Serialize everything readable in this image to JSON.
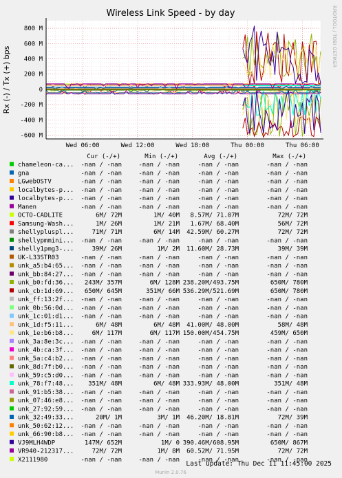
{
  "chart_data": {
    "type": "line",
    "title": "Wireless Link Speed - by day",
    "ylabel": "Rx (-) / Tx (+) bps",
    "ylim": [
      -650,
      900
    ],
    "yticks": [
      {
        "v": 800,
        "label": "800 M"
      },
      {
        "v": 600,
        "label": "600 M"
      },
      {
        "v": 400,
        "label": "400 M"
      },
      {
        "v": 200,
        "label": "200 M"
      },
      {
        "v": 0,
        "label": "0"
      },
      {
        "v": -200,
        "label": "-200 M"
      },
      {
        "v": -400,
        "label": "-400 M"
      },
      {
        "v": -600,
        "label": "-600 M"
      }
    ],
    "xlim": [
      0,
      30
    ],
    "xticks": [
      {
        "v": 4,
        "label": "Wed 06:00"
      },
      {
        "v": 10,
        "label": "Wed 12:00"
      },
      {
        "v": 16,
        "label": "Wed 18:00"
      },
      {
        "v": 22,
        "label": "Thu 00:00"
      },
      {
        "v": 28,
        "label": "Thu 06:00"
      }
    ],
    "side_label": "RRDTOOL / TOBI OETIKER",
    "columns": [
      "Cur (-/+)",
      "Min (-/+)",
      "Avg (-/+)",
      "Max (-/+)"
    ],
    "series": [
      {
        "name": "chameleon-ca...",
        "color": "#00cc00",
        "cur": "-nan / -nan",
        "min": "-nan / -nan",
        "avg": "-nan / -nan",
        "max": "-nan / -nan"
      },
      {
        "name": "gna",
        "color": "#0066b3",
        "cur": "-nan / -nan",
        "min": "-nan / -nan",
        "avg": "-nan / -nan",
        "max": "-nan / -nan"
      },
      {
        "name": "LGwebOSTV",
        "color": "#ff8000",
        "cur": "-nan / -nan",
        "min": "-nan / -nan",
        "avg": "-nan / -nan",
        "max": "-nan / -nan"
      },
      {
        "name": "localbytes-p...",
        "color": "#ffcc00",
        "cur": "-nan / -nan",
        "min": "-nan / -nan",
        "avg": "-nan / -nan",
        "max": "-nan / -nan"
      },
      {
        "name": "localbytes-p...",
        "color": "#330099",
        "cur": "-nan / -nan",
        "min": "-nan / -nan",
        "avg": "-nan / -nan",
        "max": "-nan / -nan"
      },
      {
        "name": "Manen",
        "color": "#990099",
        "cur": "-nan / -nan",
        "min": "-nan / -nan",
        "avg": "-nan / -nan",
        "max": "-nan / -nan"
      },
      {
        "name": "OCTO-CADLITE",
        "color": "#ccff00",
        "cur": "6M/ 72M",
        "min": "1M/ 40M",
        "avg": "8.57M/ 71.07M",
        "max": "72M/ 72M"
      },
      {
        "name": "Samsung-Wash...",
        "color": "#ff0000",
        "cur": "1M/ 26M",
        "min": "1M/ 21M",
        "avg": "1.67M/ 68.40M",
        "max": "56M/ 72M"
      },
      {
        "name": "shellypluspl...",
        "color": "#808080",
        "cur": "71M/ 71M",
        "min": "6M/ 14M",
        "avg": "42.59M/ 60.27M",
        "max": "72M/ 72M"
      },
      {
        "name": "shellypmmini...",
        "color": "#008f00",
        "cur": "-nan / -nan",
        "min": "-nan / -nan",
        "avg": "-nan / -nan",
        "max": "-nan / -nan"
      },
      {
        "name": "shelly1pmg3-...",
        "color": "#00487d",
        "cur": "39M/ 26M",
        "min": "1M/ 2M",
        "avg": "11.60M/ 28.73M",
        "max": "39M/ 39M"
      },
      {
        "name": "UK-L33STR03",
        "color": "#b35a00",
        "cur": "-nan / -nan",
        "min": "-nan / -nan",
        "avg": "-nan / -nan",
        "max": "-nan / -nan"
      },
      {
        "name": "unk_a5:b4:65...",
        "color": "#b38f00",
        "cur": "-nan / -nan",
        "min": "-nan / -nan",
        "avg": "-nan / -nan",
        "max": "-nan / -nan"
      },
      {
        "name": "unk_bb:84:27...",
        "color": "#6b006b",
        "cur": "-nan / -nan",
        "min": "-nan / -nan",
        "avg": "-nan / -nan",
        "max": "-nan / -nan"
      },
      {
        "name": "unk_b0:fd:36...",
        "color": "#8fb300",
        "cur": "243M/ 357M",
        "min": "6M/ 128M",
        "avg": "238.20M/493.75M",
        "max": "650M/ 780M"
      },
      {
        "name": "unk_cb:1d:69...",
        "color": "#b30000",
        "cur": "650M/ 645M",
        "min": "351M/ 66M",
        "avg": "536.29M/521.69M",
        "max": "650M/ 780M"
      },
      {
        "name": "unk_ff:13:2f...",
        "color": "#bebebe",
        "cur": "-nan / -nan",
        "min": "-nan / -nan",
        "avg": "-nan / -nan",
        "max": "-nan / -nan"
      },
      {
        "name": "unk_0b:56:0d...",
        "color": "#80ff80",
        "cur": "-nan / -nan",
        "min": "-nan / -nan",
        "avg": "-nan / -nan",
        "max": "-nan / -nan"
      },
      {
        "name": "unk_1c:01:d1...",
        "color": "#80c9ff",
        "cur": "-nan / -nan",
        "min": "-nan / -nan",
        "avg": "-nan / -nan",
        "max": "-nan / -nan"
      },
      {
        "name": "unk_1d:f5:11...",
        "color": "#ffc080",
        "cur": "6M/ 48M",
        "min": "6M/ 48M",
        "avg": "41.00M/ 48.00M",
        "max": "58M/ 48M"
      },
      {
        "name": "unk_1e:b6:b8...",
        "color": "#ffe680",
        "cur": "6M/ 117M",
        "min": "6M/ 117M",
        "avg": "150.00M/454.75M",
        "max": "459M/ 650M"
      },
      {
        "name": "unk_3a:8e:3c...",
        "color": "#aa80ff",
        "cur": "-nan / -nan",
        "min": "-nan / -nan",
        "avg": "-nan / -nan",
        "max": "-nan / -nan"
      },
      {
        "name": "unk_4b:ca:3f...",
        "color": "#ee00cc",
        "cur": "-nan / -nan",
        "min": "-nan / -nan",
        "avg": "-nan / -nan",
        "max": "-nan / -nan"
      },
      {
        "name": "unk_5a:c4:b2...",
        "color": "#ff8080",
        "cur": "-nan / -nan",
        "min": "-nan / -nan",
        "avg": "-nan / -nan",
        "max": "-nan / -nan"
      },
      {
        "name": "unk_8d:7f:b0...",
        "color": "#666600",
        "cur": "-nan / -nan",
        "min": "-nan / -nan",
        "avg": "-nan / -nan",
        "max": "-nan / -nan"
      },
      {
        "name": "unk_59:c5:d0...",
        "color": "#ffbfff",
        "cur": "-nan / -nan",
        "min": "-nan / -nan",
        "avg": "-nan / -nan",
        "max": "-nan / -nan"
      },
      {
        "name": "unk_78:f7:48...",
        "color": "#00ffcc",
        "cur": "351M/ 48M",
        "min": "6M/ 48M",
        "avg": "333.93M/ 48.00M",
        "max": "351M/ 48M"
      },
      {
        "name": "unk_91:b5:38...",
        "color": "#cc6699",
        "cur": "-nan / -nan",
        "min": "-nan / -nan",
        "avg": "-nan / -nan",
        "max": "-nan / -nan"
      },
      {
        "name": "unk_07:46:e8...",
        "color": "#999900",
        "cur": "-nan / -nan",
        "min": "-nan / -nan",
        "avg": "-nan / -nan",
        "max": "-nan / -nan"
      },
      {
        "name": "unk_27:92:59...",
        "color": "#00cc00",
        "cur": "-nan / -nan",
        "min": "-nan / -nan",
        "avg": "-nan / -nan",
        "max": "-nan / -nan"
      },
      {
        "name": "unk_32:49:33...",
        "color": "#0066b3",
        "cur": "20M/ 1M",
        "min": "3M/ 1M",
        "avg": "46.20M/ 18.81M",
        "max": "72M/ 39M"
      },
      {
        "name": "unk_50:62:12...",
        "color": "#ff8000",
        "cur": "-nan / -nan",
        "min": "-nan / -nan",
        "avg": "-nan / -nan",
        "max": "-nan / -nan"
      },
      {
        "name": "unk_66:90:b8...",
        "color": "#ffcc00",
        "cur": "-nan / -nan",
        "min": "-nan / -nan",
        "avg": "-nan / -nan",
        "max": "-nan / -nan"
      },
      {
        "name": "VJ9MLH4WDP",
        "color": "#330099",
        "cur": "147M/ 652M",
        "min": "1M/ 0",
        "avg": "390.46M/608.95M",
        "max": "650M/ 867M"
      },
      {
        "name": "VR940-212317...",
        "color": "#990099",
        "cur": "72M/ 72M",
        "min": "1M/ 8M",
        "avg": "60.52M/ 71.95M",
        "max": "72M/ 72M"
      },
      {
        "name": "X2111980",
        "color": "#ccff00",
        "cur": "-nan / -nan",
        "min": "-nan / -nan",
        "avg": "-nan / -nan",
        "max": "-nan / -nan"
      }
    ],
    "last_update": "Last update: Thu Dec 11 11:45:00 2025",
    "footer": "Munin 2.0.76"
  }
}
